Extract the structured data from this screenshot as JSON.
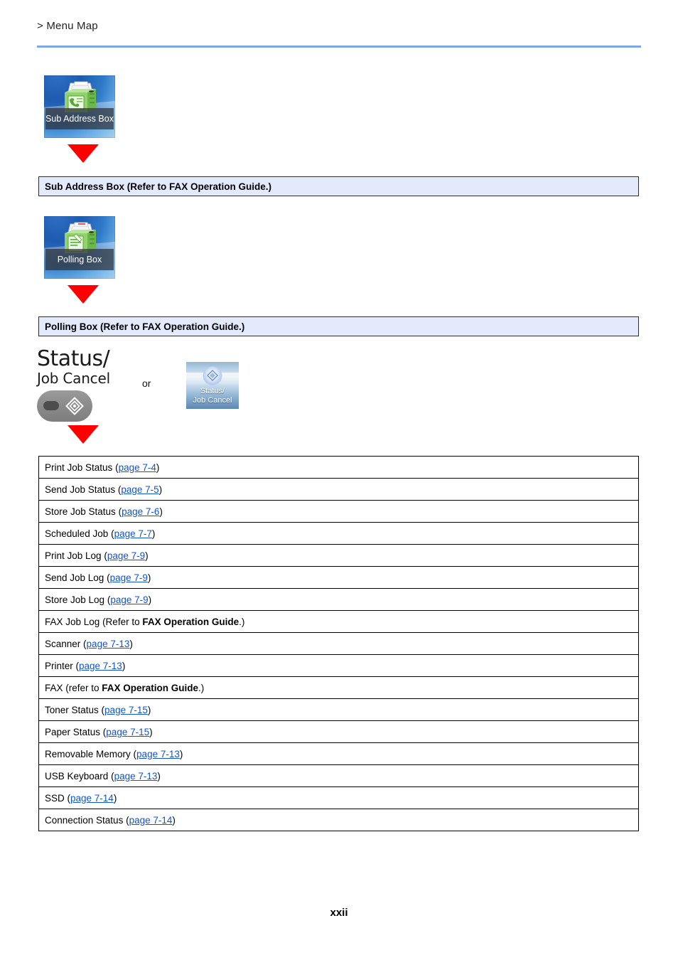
{
  "header": {
    "breadcrumb": "> Menu Map",
    "rule_color": "#7da7e8"
  },
  "groups": [
    {
      "tile_label": "Sub Address Box",
      "tile_icon": "fax-subaddress-box-icon",
      "arrow_icon": "red-down-arrow-icon",
      "section_label": "Sub Address Box (Refer to FAX Operation Guide.)"
    },
    {
      "tile_label": "Polling Box",
      "tile_icon": "fax-polling-box-icon",
      "arrow_icon": "red-down-arrow-icon",
      "section_label": "Polling Box (Refer to FAX Operation Guide.)"
    }
  ],
  "status_key": {
    "title_line1": "Status/",
    "title_line2": "Job Cancel",
    "key_icon": "status-job-cancel-key-icon",
    "led_icon": "key-led-indicator-icon",
    "or_text": "or",
    "panel_tile_label_line1": "Status/",
    "panel_tile_label_line2": "Job Cancel",
    "panel_tile_icon": "status-job-cancel-panel-icon",
    "arrow_icon": "red-down-arrow-icon"
  },
  "table": {
    "rows": [
      {
        "label": "Print Job Status",
        "open": " (",
        "link": "page 7-4",
        "close": ")"
      },
      {
        "label": "Send Job Status",
        "open": " (",
        "link": "page 7-5",
        "close": ")"
      },
      {
        "label": "Store Job Status",
        "open": " (",
        "link": "page 7-6",
        "close": ")"
      },
      {
        "label": "Scheduled Job",
        "open": " (",
        "link": "page 7-7",
        "close": ")"
      },
      {
        "label": "Print Job Log",
        "open": " (",
        "link": "page 7-9",
        "close": ")"
      },
      {
        "label": "Send Job Log",
        "open": " (",
        "link": "page 7-9",
        "close": ")"
      },
      {
        "label": "Store Job Log",
        "open": " (",
        "link": "page 7-9",
        "close": ")"
      },
      {
        "label": "FAX Job Log",
        "open": " (Refer to ",
        "bold": "FAX Operation Guide",
        "close": ".)"
      },
      {
        "label": "Scanner",
        "open": " (",
        "link": "page 7-13",
        "close": ")"
      },
      {
        "label": "Printer",
        "open": " (",
        "link": "page 7-13",
        "close": ")"
      },
      {
        "label": "FAX",
        "open": " (refer to ",
        "bold": "FAX Operation Guide",
        "close": ".)"
      },
      {
        "label": "Toner Status",
        "open": " (",
        "link": "page 7-15",
        "close": ")"
      },
      {
        "label": "Paper Status",
        "open": " (",
        "link": "page 7-15",
        "close": ")"
      },
      {
        "label": "Removable Memory",
        "open": " (",
        "link": "page 7-13",
        "close": ")"
      },
      {
        "label": "USB Keyboard",
        "open": " (",
        "link": "page 7-13",
        "close": ")"
      },
      {
        "label": "SSD",
        "open": " (",
        "link": "page 7-14",
        "close": ")"
      },
      {
        "label": "Connection Status",
        "open": " (",
        "link": "page 7-14",
        "close": ")"
      }
    ]
  },
  "footer": {
    "page_number": "xxii"
  },
  "colors": {
    "link": "#1155cc",
    "arrow_red": "#ff0000",
    "section_fill": "#e3eafb",
    "rule_blue": "#7da7e8"
  }
}
